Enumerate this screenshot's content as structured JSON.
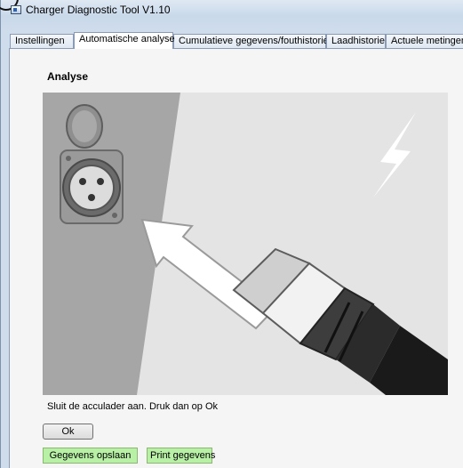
{
  "window": {
    "title": "Charger Diagnostic Tool V1.10",
    "icon": "app-window-icon"
  },
  "tabs": [
    {
      "label": "Instellingen",
      "active": false
    },
    {
      "label": "Automatische analyse",
      "active": true
    },
    {
      "label": "Cumulatieve gegevens/fouthistorie",
      "active": false
    },
    {
      "label": "Laadhistorie",
      "active": false
    },
    {
      "label": "Actuele metingen",
      "active": false
    }
  ],
  "analysis": {
    "section_title": "Analyse",
    "illustration": "connector-plug-in-illustration",
    "instruction": "Sluit de acculader aan. Druk dan op Ok",
    "ok_label": "Ok",
    "save_label": "Gegevens opslaan",
    "print_label": "Print gegevens"
  },
  "colors": {
    "green_button": "#b8f0a6",
    "panel_background": "#f5f5f5",
    "illustration_wall": "#a6a6a6",
    "illustration_background": "#e4e4e4"
  }
}
